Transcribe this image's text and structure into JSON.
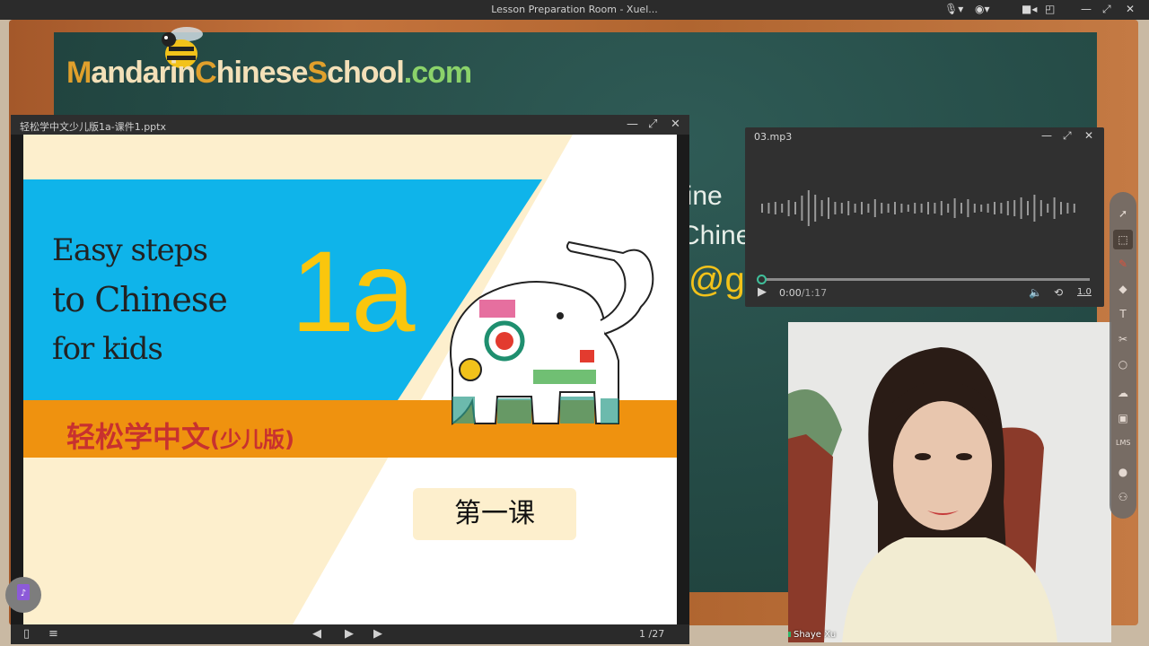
{
  "window": {
    "title": "Lesson Preparation Room - Xuel..."
  },
  "brand": {
    "logo_part1": "M",
    "logo_part2": "andarin",
    "logo_part3": "C",
    "logo_part4": "hinese",
    "logo_part5": "S",
    "logo_part6": "chool",
    "logo_part7": ".com"
  },
  "board": {
    "line1": "line",
    "line2": "Chine",
    "line3": "l@g"
  },
  "pptx": {
    "filename": "轻松学中文少儿版1a-课件1.pptx",
    "page_current": "1",
    "page_total": "/27",
    "slide": {
      "title_en_1": "Easy steps",
      "title_en_2": "to Chinese",
      "title_en_3": "for kids",
      "level": "1a",
      "title_cn": "轻松学中文",
      "title_cn_sub": "(少儿版)",
      "lesson": "第一课"
    }
  },
  "audio": {
    "filename": "03.mp3",
    "time_current": "0:00",
    "time_total": "/1:17",
    "speed": "1.0",
    "progress": 0
  },
  "video": {
    "participant_name": "Shaye Xu"
  },
  "colors": {
    "slide_blue": "#0fb4ea",
    "slide_orange": "#ef920f",
    "slide_cream": "#fdefcd",
    "level_yellow": "#fac60d",
    "title_cn_red": "#c8312f",
    "board_green": "#234843",
    "audio_accent": "#3fbf9a"
  }
}
